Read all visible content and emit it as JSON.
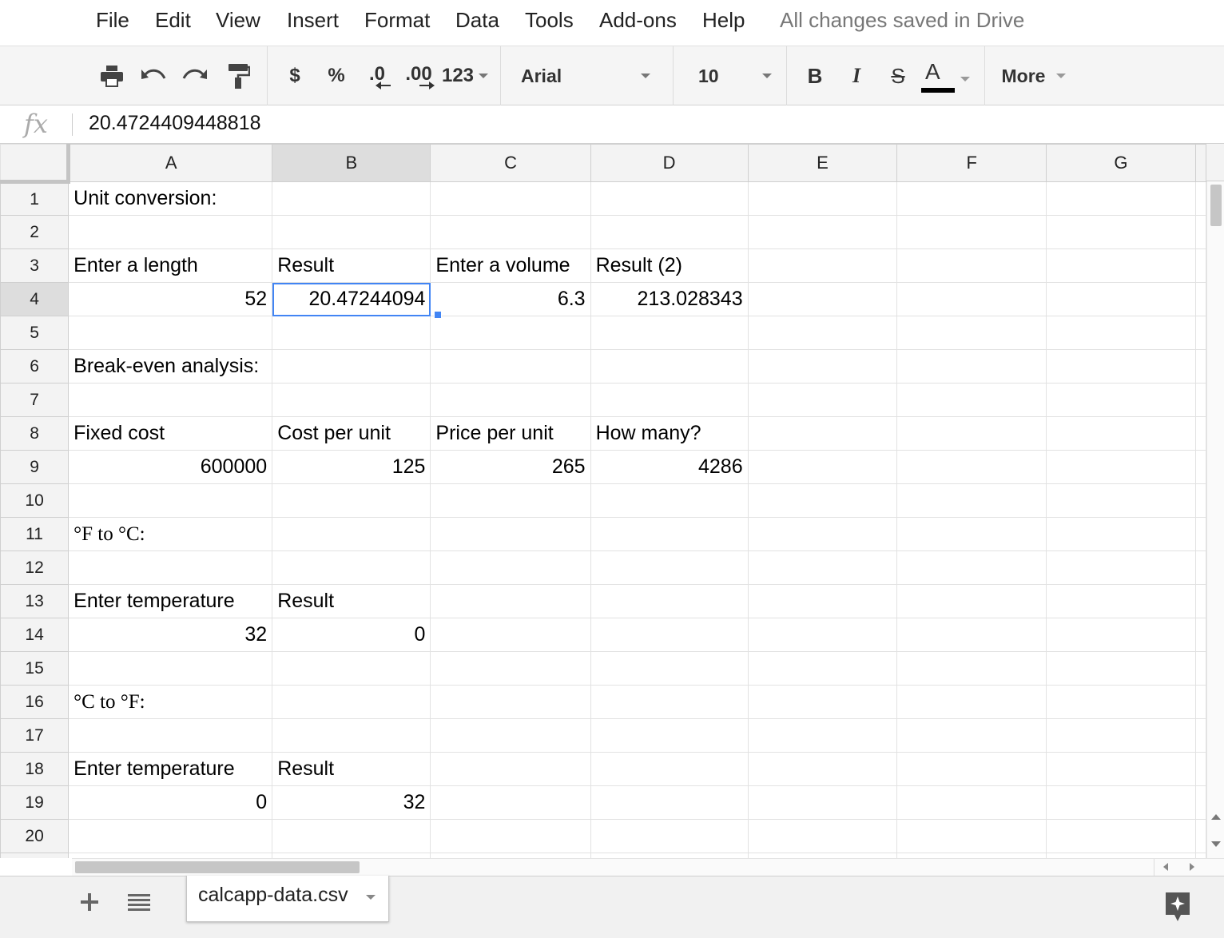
{
  "menu": {
    "items": [
      "File",
      "Edit",
      "View",
      "Insert",
      "Format",
      "Data",
      "Tools",
      "Add-ons",
      "Help"
    ],
    "save_status": "All changes saved in Drive"
  },
  "toolbar": {
    "currency": "$",
    "percent": "%",
    "decrease_decimal": ".0",
    "increase_decimal": ".00",
    "more_formats": "123",
    "font": "Arial",
    "font_size": "10",
    "bold": "B",
    "italic": "I",
    "strikethrough": "S",
    "text_color": "A",
    "more": "More",
    "text_color_swatch": "#000000"
  },
  "formula_bar": {
    "icon": "fx",
    "value": "20.4724409448818"
  },
  "grid": {
    "columns": [
      "A",
      "B",
      "C",
      "D",
      "E",
      "F",
      "G"
    ],
    "active_column": "B",
    "active_row": "4",
    "rows": [
      {
        "n": "1",
        "cells": [
          "Unit conversion:",
          "",
          "",
          "",
          "",
          "",
          ""
        ]
      },
      {
        "n": "2",
        "cells": [
          "",
          "",
          "",
          "",
          "",
          "",
          ""
        ]
      },
      {
        "n": "3",
        "cells": [
          "Enter a length",
          "Result",
          "Enter a volume",
          "Result (2)",
          "",
          "",
          ""
        ]
      },
      {
        "n": "4",
        "cells": [
          "52",
          "20.47244094",
          "6.3",
          "213.028343",
          "",
          "",
          ""
        ]
      },
      {
        "n": "5",
        "cells": [
          "",
          "",
          "",
          "",
          "",
          "",
          ""
        ]
      },
      {
        "n": "6",
        "cells": [
          "Break-even analysis:",
          "",
          "",
          "",
          "",
          "",
          ""
        ]
      },
      {
        "n": "7",
        "cells": [
          "",
          "",
          "",
          "",
          "",
          "",
          ""
        ]
      },
      {
        "n": "8",
        "cells": [
          "Fixed cost",
          "Cost per unit",
          "Price per unit",
          "How many?",
          "",
          "",
          ""
        ]
      },
      {
        "n": "9",
        "cells": [
          "600000",
          "125",
          "265",
          "4286",
          "",
          "",
          ""
        ]
      },
      {
        "n": "10",
        "cells": [
          "",
          "",
          "",
          "",
          "",
          "",
          ""
        ]
      },
      {
        "n": "11",
        "cells": [
          "°F to °C:",
          "",
          "",
          "",
          "",
          "",
          ""
        ]
      },
      {
        "n": "12",
        "cells": [
          "",
          "",
          "",
          "",
          "",
          "",
          ""
        ]
      },
      {
        "n": "13",
        "cells": [
          "Enter temperature",
          "Result",
          "",
          "",
          "",
          "",
          ""
        ]
      },
      {
        "n": "14",
        "cells": [
          "32",
          "0",
          "",
          "",
          "",
          "",
          ""
        ]
      },
      {
        "n": "15",
        "cells": [
          "",
          "",
          "",
          "",
          "",
          "",
          ""
        ]
      },
      {
        "n": "16",
        "cells": [
          "°C to °F:",
          "",
          "",
          "",
          "",
          "",
          ""
        ]
      },
      {
        "n": "17",
        "cells": [
          "",
          "",
          "",
          "",
          "",
          "",
          ""
        ]
      },
      {
        "n": "18",
        "cells": [
          "Enter temperature",
          "Result",
          "",
          "",
          "",
          "",
          ""
        ]
      },
      {
        "n": "19",
        "cells": [
          "0",
          "32",
          "",
          "",
          "",
          "",
          ""
        ]
      },
      {
        "n": "20",
        "cells": [
          "",
          "",
          "",
          "",
          "",
          "",
          ""
        ]
      }
    ]
  },
  "sheets": {
    "active_tab": "calcapp-data.csv"
  },
  "colors": {
    "selection": "#4285f4",
    "header_bg": "#f3f3f3",
    "toolbar_bg": "#f5f5f5"
  }
}
